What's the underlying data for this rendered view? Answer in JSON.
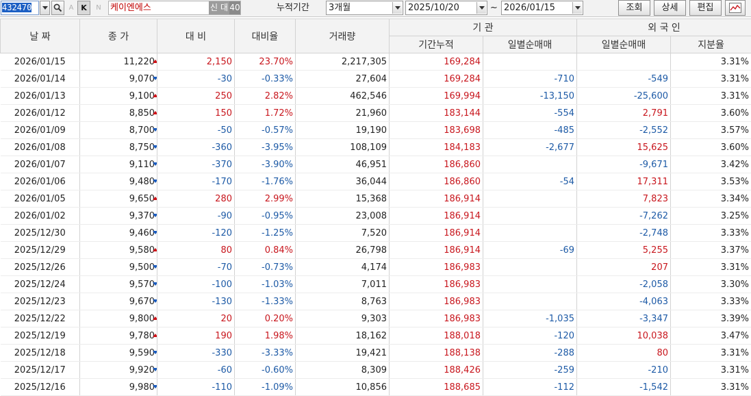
{
  "toolbar": {
    "code_value": "432470",
    "code_dropdown": "dropdown-arrow-icon",
    "search_icon": "magnifier-icon",
    "label_a": "A",
    "k_button": "K",
    "label_n": "N",
    "stock_name": "케이엔에스",
    "tag_new": "신",
    "tag_loan": "대",
    "tag_margin": "40",
    "period_label": "누적기간",
    "period_value": "3개월",
    "date_from": "2025/10/20",
    "range_sep": "~",
    "date_to": "2026/01/15",
    "query_button": "조회",
    "detail_button": "상세",
    "edit_button": "편집",
    "chart_icon": "chart-icon",
    "colors": {
      "up": "#c8161d",
      "down": "#1d5aa6"
    }
  },
  "headers": {
    "date": "날 짜",
    "close": "종 가",
    "change": "대 비",
    "change_rate": "대비율",
    "volume": "거래량",
    "institution": "기 관",
    "inst_cumulative": "기간누적",
    "inst_daily": "일별순매매",
    "foreign": "외 국 인",
    "foreign_daily": "일별순매매",
    "foreign_share": "지분율"
  },
  "rows": [
    {
      "date": "2026/01/15",
      "close": "11,220",
      "dir": "up",
      "change": "2,150",
      "rate": "23.70%",
      "volume": "2,217,305",
      "inst_cum": "169,284",
      "inst_daily": "",
      "for_daily": "",
      "for_share": "3.31%"
    },
    {
      "date": "2026/01/14",
      "close": "9,070",
      "dir": "down",
      "change": "-30",
      "rate": "-0.33%",
      "volume": "27,604",
      "inst_cum": "169,284",
      "inst_daily": "-710",
      "for_daily": "-549",
      "for_share": "3.31%"
    },
    {
      "date": "2026/01/13",
      "close": "9,100",
      "dir": "up",
      "change": "250",
      "rate": "2.82%",
      "volume": "462,546",
      "inst_cum": "169,994",
      "inst_daily": "-13,150",
      "for_daily": "-25,600",
      "for_share": "3.31%"
    },
    {
      "date": "2026/01/12",
      "close": "8,850",
      "dir": "up",
      "change": "150",
      "rate": "1.72%",
      "volume": "21,960",
      "inst_cum": "183,144",
      "inst_daily": "-554",
      "for_daily": "2,791",
      "for_share": "3.60%"
    },
    {
      "date": "2026/01/09",
      "close": "8,700",
      "dir": "down",
      "change": "-50",
      "rate": "-0.57%",
      "volume": "19,190",
      "inst_cum": "183,698",
      "inst_daily": "-485",
      "for_daily": "-2,552",
      "for_share": "3.57%"
    },
    {
      "date": "2026/01/08",
      "close": "8,750",
      "dir": "down",
      "change": "-360",
      "rate": "-3.95%",
      "volume": "108,109",
      "inst_cum": "184,183",
      "inst_daily": "-2,677",
      "for_daily": "15,625",
      "for_share": "3.60%"
    },
    {
      "date": "2026/01/07",
      "close": "9,110",
      "dir": "down",
      "change": "-370",
      "rate": "-3.90%",
      "volume": "46,951",
      "inst_cum": "186,860",
      "inst_daily": "",
      "for_daily": "-9,671",
      "for_share": "3.42%"
    },
    {
      "date": "2026/01/06",
      "close": "9,480",
      "dir": "down",
      "change": "-170",
      "rate": "-1.76%",
      "volume": "36,044",
      "inst_cum": "186,860",
      "inst_daily": "-54",
      "for_daily": "17,311",
      "for_share": "3.53%"
    },
    {
      "date": "2026/01/05",
      "close": "9,650",
      "dir": "up",
      "change": "280",
      "rate": "2.99%",
      "volume": "15,368",
      "inst_cum": "186,914",
      "inst_daily": "",
      "for_daily": "7,823",
      "for_share": "3.34%"
    },
    {
      "date": "2026/01/02",
      "close": "9,370",
      "dir": "down",
      "change": "-90",
      "rate": "-0.95%",
      "volume": "23,008",
      "inst_cum": "186,914",
      "inst_daily": "",
      "for_daily": "-7,262",
      "for_share": "3.25%"
    },
    {
      "date": "2025/12/30",
      "close": "9,460",
      "dir": "down",
      "change": "-120",
      "rate": "-1.25%",
      "volume": "7,520",
      "inst_cum": "186,914",
      "inst_daily": "",
      "for_daily": "-2,748",
      "for_share": "3.33%"
    },
    {
      "date": "2025/12/29",
      "close": "9,580",
      "dir": "up",
      "change": "80",
      "rate": "0.84%",
      "volume": "26,798",
      "inst_cum": "186,914",
      "inst_daily": "-69",
      "for_daily": "5,255",
      "for_share": "3.37%"
    },
    {
      "date": "2025/12/26",
      "close": "9,500",
      "dir": "down",
      "change": "-70",
      "rate": "-0.73%",
      "volume": "4,174",
      "inst_cum": "186,983",
      "inst_daily": "",
      "for_daily": "207",
      "for_share": "3.31%"
    },
    {
      "date": "2025/12/24",
      "close": "9,570",
      "dir": "down",
      "change": "-100",
      "rate": "-1.03%",
      "volume": "7,011",
      "inst_cum": "186,983",
      "inst_daily": "",
      "for_daily": "-2,058",
      "for_share": "3.30%"
    },
    {
      "date": "2025/12/23",
      "close": "9,670",
      "dir": "down",
      "change": "-130",
      "rate": "-1.33%",
      "volume": "8,763",
      "inst_cum": "186,983",
      "inst_daily": "",
      "for_daily": "-4,063",
      "for_share": "3.33%"
    },
    {
      "date": "2025/12/22",
      "close": "9,800",
      "dir": "up",
      "change": "20",
      "rate": "0.20%",
      "volume": "9,303",
      "inst_cum": "186,983",
      "inst_daily": "-1,035",
      "for_daily": "-3,347",
      "for_share": "3.39%"
    },
    {
      "date": "2025/12/19",
      "close": "9,780",
      "dir": "up",
      "change": "190",
      "rate": "1.98%",
      "volume": "18,162",
      "inst_cum": "188,018",
      "inst_daily": "-120",
      "for_daily": "10,038",
      "for_share": "3.47%"
    },
    {
      "date": "2025/12/18",
      "close": "9,590",
      "dir": "down",
      "change": "-330",
      "rate": "-3.33%",
      "volume": "19,421",
      "inst_cum": "188,138",
      "inst_daily": "-288",
      "for_daily": "80",
      "for_share": "3.31%"
    },
    {
      "date": "2025/12/17",
      "close": "9,920",
      "dir": "down",
      "change": "-60",
      "rate": "-0.60%",
      "volume": "8,309",
      "inst_cum": "188,426",
      "inst_daily": "-259",
      "for_daily": "-210",
      "for_share": "3.31%"
    },
    {
      "date": "2025/12/16",
      "close": "9,980",
      "dir": "down",
      "change": "-110",
      "rate": "-1.09%",
      "volume": "10,856",
      "inst_cum": "188,685",
      "inst_daily": "-112",
      "for_daily": "-1,542",
      "for_share": "3.31%"
    }
  ]
}
